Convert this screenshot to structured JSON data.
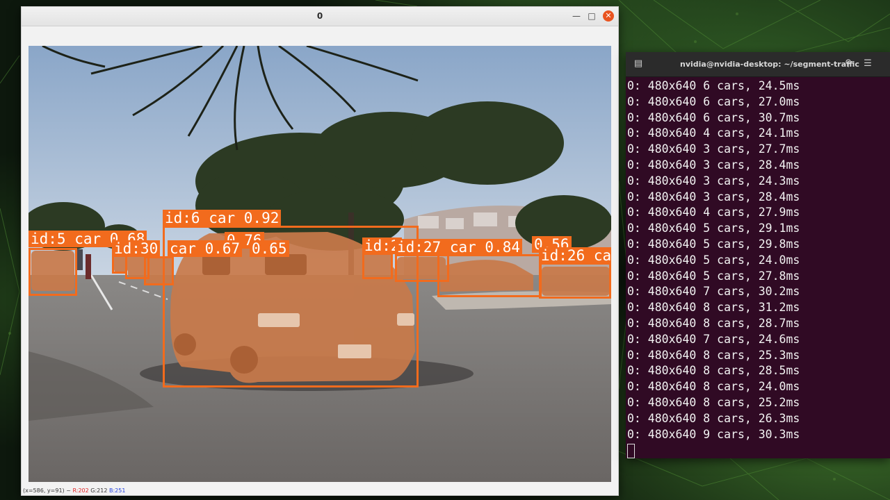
{
  "viewer": {
    "title": "0",
    "status": {
      "coords": "(x=586, y=91) ~",
      "r": "R:202",
      "g": "G:212",
      "b": "B:251"
    },
    "detections": [
      {
        "label": "id:6 car 0.92",
        "color": "#f26b1d"
      },
      {
        "label": "id:5 car 0.68",
        "color": "#f26b1d"
      },
      {
        "label": "0.76",
        "color": "#f26b1d"
      },
      {
        "label": "id:30",
        "color": "#f26b1d"
      },
      {
        "label": "car 0.67",
        "color": "#f26b1d"
      },
      {
        "label": "0.65",
        "color": "#f26b1d"
      },
      {
        "label": "id:2",
        "color": "#f26b1d"
      },
      {
        "label": "id:27 car 0.84",
        "color": "#f26b1d"
      },
      {
        "label": "0.56",
        "color": "#f26b1d"
      },
      {
        "label": "id:26 ca",
        "color": "#f26b1d"
      }
    ]
  },
  "terminal": {
    "title": "nvidia@nvidia-desktop: ~/segment-traffic",
    "lines": [
      "0: 480x640 6 cars, 24.5ms",
      "0: 480x640 6 cars, 27.0ms",
      "0: 480x640 6 cars, 30.7ms",
      "0: 480x640 4 cars, 24.1ms",
      "0: 480x640 3 cars, 27.7ms",
      "0: 480x640 3 cars, 28.4ms",
      "0: 480x640 3 cars, 24.3ms",
      "0: 480x640 3 cars, 28.4ms",
      "0: 480x640 4 cars, 27.9ms",
      "0: 480x640 5 cars, 29.1ms",
      "0: 480x640 5 cars, 29.8ms",
      "0: 480x640 5 cars, 24.0ms",
      "0: 480x640 5 cars, 27.8ms",
      "0: 480x640 7 cars, 30.2ms",
      "0: 480x640 8 cars, 31.2ms",
      "0: 480x640 8 cars, 28.7ms",
      "0: 480x640 7 cars, 24.6ms",
      "0: 480x640 8 cars, 25.3ms",
      "0: 480x640 8 cars, 28.5ms",
      "0: 480x640 8 cars, 24.0ms",
      "0: 480x640 8 cars, 25.2ms",
      "0: 480x640 8 cars, 26.3ms",
      "0: 480x640 9 cars, 30.3ms"
    ]
  }
}
